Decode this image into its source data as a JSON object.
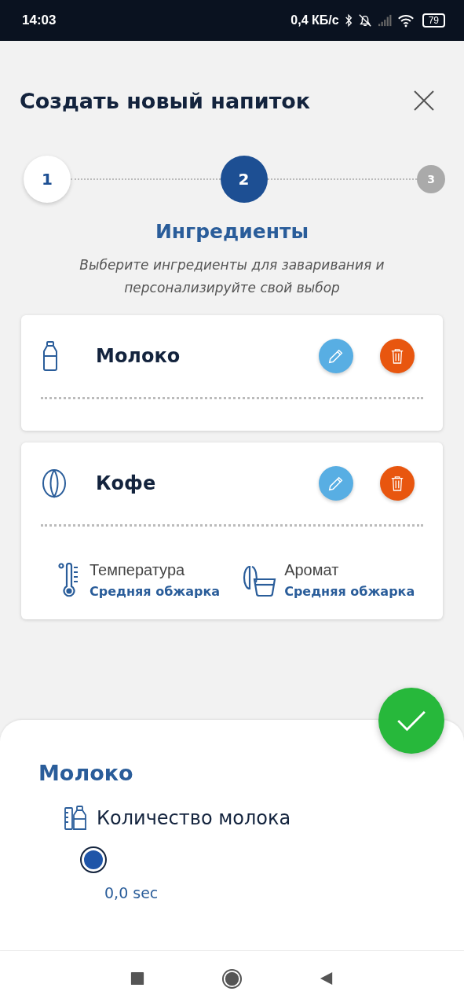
{
  "status_bar": {
    "time": "14:03",
    "speed": "0,4 КБ/с",
    "battery": "79"
  },
  "header": {
    "title": "Создать новый напиток"
  },
  "steps": [
    {
      "label": "1",
      "completed": true,
      "selected": false
    },
    {
      "label": "2",
      "completed": false,
      "selected": true
    },
    {
      "label": "3",
      "completed": false,
      "selected": false
    }
  ],
  "section": {
    "title": "Ингредиенты",
    "subtitle": "Выберите ингредиенты для заваривания и персонализируйте свой выбор"
  },
  "ingredients": [
    {
      "name": "Молоко",
      "kind": "bottle"
    },
    {
      "name": "Кофе",
      "kind": "bean",
      "properties": [
        {
          "kind": "thermometer",
          "label": "Температура",
          "value": "Средняя обжарка"
        },
        {
          "kind": "aroma",
          "label": "Аромат",
          "value": "Средняя обжарка"
        }
      ]
    }
  ],
  "sheet": {
    "title": "Молоко",
    "setting": {
      "label": "Количество молока",
      "reading": "0,0 sec"
    }
  }
}
